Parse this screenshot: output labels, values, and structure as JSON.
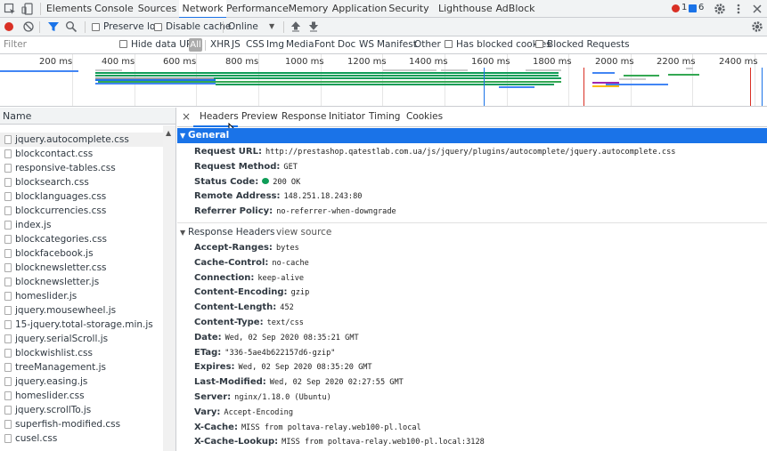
{
  "tabs": [
    "Elements",
    "Console",
    "Sources",
    "Network",
    "Performance",
    "Memory",
    "Application",
    "Security",
    "Lighthouse",
    "AdBlock"
  ],
  "badges": {
    "errors": "1",
    "warnings": "6"
  },
  "toolbar": {
    "preserve_log": "Preserve log",
    "disable_cache": "Disable cache",
    "throttle": "Online"
  },
  "filter": {
    "placeholder": "Filter",
    "hide_data_urls": "Hide data URLs",
    "all": "All",
    "types": [
      "XHR",
      "JS",
      "CSS",
      "Img",
      "Media",
      "Font",
      "Doc",
      "WS",
      "Manifest",
      "Other"
    ],
    "has_blocked": "Has blocked cookies",
    "blocked_requests": "Blocked Requests"
  },
  "timeline": {
    "ticks": [
      "200 ms",
      "400 ms",
      "600 ms",
      "800 ms",
      "1000 ms",
      "1200 ms",
      "1400 ms",
      "1600 ms",
      "1800 ms",
      "2000 ms",
      "2200 ms",
      "2400 ms"
    ]
  },
  "name_header": "Name",
  "files": [
    "jquery.autocomplete.css",
    "blockcontact.css",
    "responsive-tables.css",
    "blocksearch.css",
    "blocklanguages.css",
    "blockcurrencies.css",
    "index.js",
    "blockcategories.css",
    "blockfacebook.js",
    "blocknewsletter.css",
    "blocknewsletter.js",
    "homeslider.js",
    "jquery.mousewheel.js",
    "15-jquery.total-storage.min.js",
    "jquery.serialScroll.js",
    "blockwishlist.css",
    "treeManagement.js",
    "jquery.easing.js",
    "homeslider.css",
    "jquery.scrollTo.js",
    "superfish-modified.css",
    "cusel.css"
  ],
  "detail_tabs": [
    "Headers",
    "Preview",
    "Response",
    "Initiator",
    "Timing",
    "Cookies"
  ],
  "general": {
    "title": "General",
    "rows": [
      {
        "k": "Request URL:",
        "v": "http://prestashop.qatestlab.com.ua/js/jquery/plugins/autocomplete/jquery.autocomplete.css"
      },
      {
        "k": "Request Method:",
        "v": "GET"
      },
      {
        "k": "Status Code:",
        "v": "200 OK"
      },
      {
        "k": "Remote Address:",
        "v": "148.251.18.243:80"
      },
      {
        "k": "Referrer Policy:",
        "v": "no-referrer-when-downgrade"
      }
    ]
  },
  "response_headers": {
    "title": "Response Headers",
    "view_source": "view source",
    "rows": [
      {
        "k": "Accept-Ranges:",
        "v": "bytes"
      },
      {
        "k": "Cache-Control:",
        "v": "no-cache"
      },
      {
        "k": "Connection:",
        "v": "keep-alive"
      },
      {
        "k": "Content-Encoding:",
        "v": "gzip"
      },
      {
        "k": "Content-Length:",
        "v": "452"
      },
      {
        "k": "Content-Type:",
        "v": "text/css"
      },
      {
        "k": "Date:",
        "v": "Wed, 02 Sep 2020 08:35:21 GMT"
      },
      {
        "k": "ETag:",
        "v": "\"336-5ae4b622157d6-gzip\""
      },
      {
        "k": "Expires:",
        "v": "Wed, 02 Sep 2020 08:35:20 GMT"
      },
      {
        "k": "Last-Modified:",
        "v": "Wed, 02 Sep 2020 02:27:55 GMT"
      },
      {
        "k": "Server:",
        "v": "nginx/1.18.0 (Ubuntu)"
      },
      {
        "k": "Vary:",
        "v": "Accept-Encoding"
      },
      {
        "k": "X-Cache:",
        "v": "MISS from poltava-relay.web100-pl.local"
      },
      {
        "k": "X-Cache-Lookup:",
        "v": "MISS from poltava-relay.web100-pl.local:3128"
      }
    ]
  },
  "colors": {
    "accent": "#1a73e8",
    "record": "#d93025",
    "status_ok": "#0f9d58"
  }
}
